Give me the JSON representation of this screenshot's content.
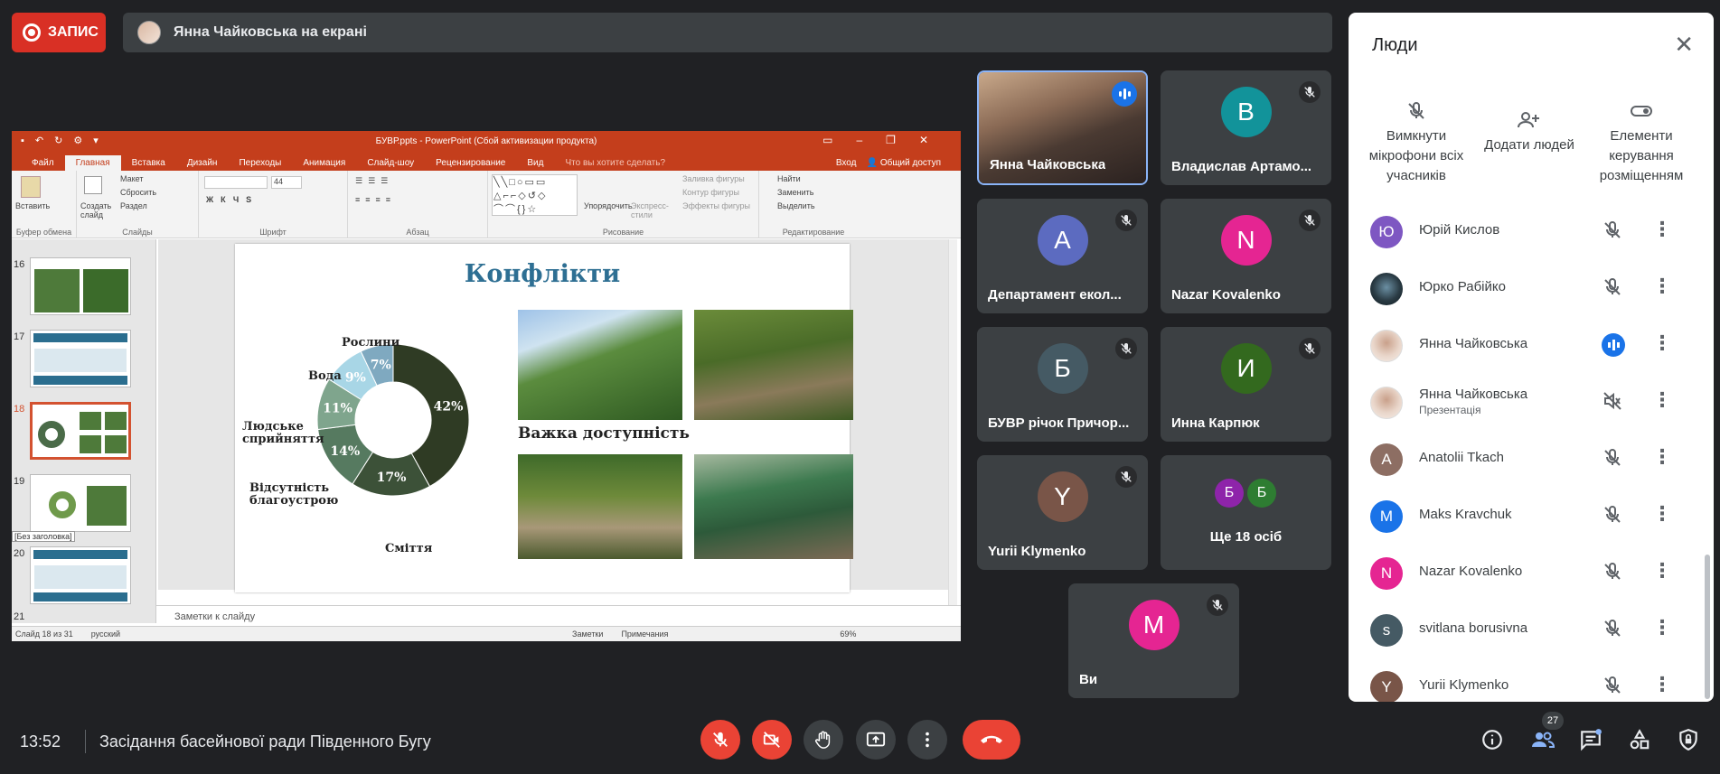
{
  "top": {
    "record_label": "ЗАПИС",
    "presenter_bar": "Янна Чайковська на екрані"
  },
  "ppt": {
    "window_title": "БУВР.ppts - PowerPoint (Сбой активизации продукта)",
    "tabs": [
      "Файл",
      "Главная",
      "Вставка",
      "Дизайн",
      "Переходы",
      "Анимация",
      "Слайд-шоу",
      "Рецензирование",
      "Вид",
      "Что вы хотите сделать?"
    ],
    "active_tab": "Главная",
    "signin": "Вход",
    "share": "Общий доступ",
    "groups": [
      "Буфер обмена",
      "Слайды",
      "Шрифт",
      "Абзац",
      "Рисование",
      "Редактирование"
    ],
    "ribbon": {
      "paste": "Вставить",
      "create_slide": "Создать слайд",
      "layout": "Макет",
      "reset": "Сбросить",
      "section": "Раздел",
      "font_size": "44",
      "arrange": "Упорядочить",
      "express_styles": "Экспресс-стили",
      "shape_fill": "Заливка фигуры",
      "shape_outline": "Контур фигуры",
      "shape_effects": "Эффекты фигуры",
      "find": "Найти",
      "replace": "Заменить",
      "select": "Выделить"
    },
    "thumb_numbers": [
      "16",
      "17",
      "18",
      "19",
      "20",
      "21"
    ],
    "thumb_tooltip": "[Без заголовка]",
    "notes_placeholder": "Заметки к слайду",
    "status": {
      "slide": "Слайд 18 из 31",
      "lang": "русский",
      "notes": "Заметки",
      "comments": "Примечания",
      "zoom": "69%"
    }
  },
  "slide": {
    "title": "Конфлікти",
    "caption": "Важка доступність",
    "donut_labels": {
      "plants": "Рослини",
      "water": "Вода",
      "human": "Людське сприйняття",
      "landscaping": "Відсутність благоустрою",
      "trash": "Сміття"
    },
    "donut_values": [
      {
        "label": "42%",
        "value": 42,
        "color": "#2f3b24"
      },
      {
        "label": "17%",
        "value": 17,
        "color": "#3c5138"
      },
      {
        "label": "14%",
        "value": 14,
        "color": "#567a60"
      },
      {
        "label": "11%",
        "value": 11,
        "color": "#7fa58d"
      },
      {
        "label": "9%",
        "value": 9,
        "color": "#a8d6e6"
      },
      {
        "label": "7%",
        "value": 7,
        "color": "#7fa9c0"
      }
    ]
  },
  "tiles": [
    {
      "name": "Янна Чайковська",
      "type": "video",
      "talking": true
    },
    {
      "name": "Владислав Артамо...",
      "initial": "В",
      "color": "#12939a"
    },
    {
      "name": "Департамент екол...",
      "initial": "А",
      "color": "#5c6bc0"
    },
    {
      "name": "Nazar Kovalenko",
      "initial": "N",
      "color": "#e52592"
    },
    {
      "name": "БУВР річок Причор...",
      "initial": "Б",
      "color": "#455a64"
    },
    {
      "name": "Инна Карпюк",
      "initial": "И",
      "color": "#33691e"
    },
    {
      "name": "Yurii Klymenko",
      "initial": "Y",
      "color": "#795548"
    },
    {
      "name": "Ще 18 осіб",
      "group": [
        {
          "initial": "Б",
          "color": "#8e24aa"
        },
        {
          "initial": "Б",
          "color": "#2e7d32"
        }
      ]
    },
    {
      "name": "Ви",
      "initial": "M",
      "color": "#e52592"
    }
  ],
  "panel": {
    "title": "Люди",
    "actions": [
      {
        "label": "Вимкнути мікрофони всіх учасників",
        "icon": "mic-off-icon"
      },
      {
        "label": "Додати людей",
        "icon": "person-add-icon"
      },
      {
        "label": "Елементи керування розміщенням",
        "icon": "toggle-icon"
      }
    ],
    "people": [
      {
        "name": "Юрій Кислов",
        "initial": "Ю",
        "color": "#7e57c2",
        "mic": "off"
      },
      {
        "name": "Юрко Рабійко",
        "photo": "dark",
        "mic": "off"
      },
      {
        "name": "Янна Чайковська",
        "photo": "light",
        "mic": "talking"
      },
      {
        "name": "Янна Чайковська",
        "sub": "Презентація",
        "photo": "light",
        "mic": "muted-audio"
      },
      {
        "name": "Anatolii Tkach",
        "initial": "A",
        "color": "#8d6e63",
        "mic": "off"
      },
      {
        "name": "Maks Kravchuk",
        "initial": "M",
        "color": "#1a73e8",
        "mic": "off"
      },
      {
        "name": "Nazar Kovalenko",
        "initial": "N",
        "color": "#e52592",
        "mic": "off"
      },
      {
        "name": "svitlana borusivna",
        "initial": "s",
        "color": "#455a64",
        "mic": "off"
      },
      {
        "name": "Yurii Klymenko",
        "initial": "Y",
        "color": "#795548",
        "mic": "off"
      }
    ]
  },
  "bottom": {
    "time": "13:52",
    "meeting": "Засідання басейнової ради Південного Бугу",
    "participants_count": "27"
  }
}
